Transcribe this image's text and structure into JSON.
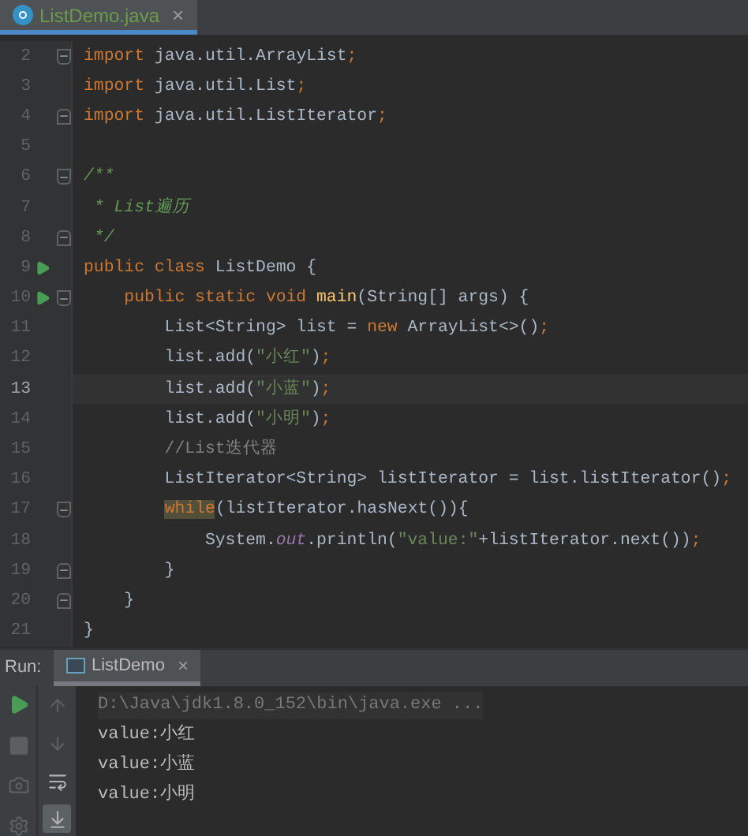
{
  "editor_tabs": [
    {
      "label": "ListDemo.java",
      "selected": true,
      "close": "×"
    }
  ],
  "code_lines": [
    {
      "number": "2",
      "fold_start": true,
      "fold_end": false,
      "run": false,
      "current": false,
      "tokens": [
        {
          "kind": "keyword",
          "text": "import "
        },
        {
          "kind": "plain",
          "text": "java.util.ArrayList"
        },
        {
          "kind": "keyword",
          "text": ";"
        }
      ]
    },
    {
      "number": "3",
      "fold_start": false,
      "fold_end": false,
      "run": false,
      "current": false,
      "tokens": [
        {
          "kind": "keyword",
          "text": "import "
        },
        {
          "kind": "plain",
          "text": "java.util.List"
        },
        {
          "kind": "keyword",
          "text": ";"
        }
      ]
    },
    {
      "number": "4",
      "fold_start": false,
      "fold_end": true,
      "run": false,
      "current": false,
      "tokens": [
        {
          "kind": "keyword",
          "text": "import "
        },
        {
          "kind": "plain",
          "text": "java.util.ListIterator"
        },
        {
          "kind": "keyword",
          "text": ";"
        }
      ]
    },
    {
      "number": "5",
      "fold_start": false,
      "fold_end": false,
      "run": false,
      "current": false
    },
    {
      "number": "6",
      "fold_start": true,
      "fold_end": false,
      "run": false,
      "current": false,
      "tokens": [
        {
          "kind": "doc",
          "text": "/**"
        }
      ]
    },
    {
      "number": "7",
      "fold_start": false,
      "fold_end": false,
      "run": false,
      "current": false,
      "tokens": [
        {
          "kind": "doc",
          "text": " * List遍历"
        }
      ]
    },
    {
      "number": "8",
      "fold_start": false,
      "fold_end": true,
      "run": false,
      "current": false,
      "tokens": [
        {
          "kind": "doc",
          "text": " */"
        }
      ]
    },
    {
      "number": "9",
      "fold_start": false,
      "fold_end": false,
      "run": true,
      "current": false,
      "tokens": [
        {
          "kind": "keyword",
          "text": "public class "
        },
        {
          "kind": "plain",
          "text": "ListDemo {"
        }
      ]
    },
    {
      "number": "10",
      "fold_start": true,
      "fold_end": false,
      "run": true,
      "current": false,
      "tokens": [
        {
          "kind": "keyword",
          "text": "    public static void "
        },
        {
          "kind": "method",
          "text": "main"
        },
        {
          "kind": "plain",
          "text": "(String[] args) {"
        }
      ]
    },
    {
      "number": "11",
      "fold_start": false,
      "fold_end": false,
      "run": false,
      "current": false,
      "tokens": [
        {
          "kind": "plain",
          "text": "        List<String> list = "
        },
        {
          "kind": "keyword",
          "text": "new "
        },
        {
          "kind": "plain",
          "text": "ArrayList<>()"
        },
        {
          "kind": "keyword",
          "text": ";"
        }
      ]
    },
    {
      "number": "12",
      "fold_start": false,
      "fold_end": false,
      "run": false,
      "current": false,
      "tokens": [
        {
          "kind": "plain",
          "text": "        list.add("
        },
        {
          "kind": "string",
          "text": "\"小红\""
        },
        {
          "kind": "plain",
          "text": ")"
        },
        {
          "kind": "keyword",
          "text": ";"
        }
      ]
    },
    {
      "number": "13",
      "fold_start": false,
      "fold_end": false,
      "run": false,
      "current": true,
      "tokens": [
        {
          "kind": "plain",
          "text": "        list.add("
        },
        {
          "kind": "string",
          "text": "\"小蓝\""
        },
        {
          "kind": "plain",
          "text": ")"
        },
        {
          "kind": "keyword",
          "text": ";"
        }
      ]
    },
    {
      "number": "14",
      "fold_start": false,
      "fold_end": false,
      "run": false,
      "current": false,
      "tokens": [
        {
          "kind": "plain",
          "text": "        list.add("
        },
        {
          "kind": "string",
          "text": "\"小明\""
        },
        {
          "kind": "plain",
          "text": ")"
        },
        {
          "kind": "keyword",
          "text": ";"
        }
      ]
    },
    {
      "number": "15",
      "fold_start": false,
      "fold_end": false,
      "run": false,
      "current": false,
      "tokens": [
        {
          "kind": "comment",
          "text": "        //List迭代器"
        }
      ]
    },
    {
      "number": "16",
      "fold_start": false,
      "fold_end": false,
      "run": false,
      "current": false,
      "tokens": [
        {
          "kind": "plain",
          "text": "        ListIterator<String> listIterator = list.listIterator()"
        },
        {
          "kind": "keyword",
          "text": ";"
        }
      ]
    },
    {
      "number": "17",
      "fold_start": true,
      "fold_end": false,
      "run": false,
      "current": false,
      "tokens": [
        {
          "kind": "highlight",
          "text": "while"
        },
        {
          "kind": "plain",
          "text": "(listIterator.hasNext()){"
        }
      ],
      "indent": true
    },
    {
      "number": "18",
      "fold_start": false,
      "fold_end": false,
      "run": false,
      "current": false,
      "tokens": [
        {
          "kind": "plain",
          "text": "            System."
        },
        {
          "kind": "field",
          "text": "out"
        },
        {
          "kind": "plain",
          "text": ".println("
        },
        {
          "kind": "string",
          "text": "\"value:\""
        },
        {
          "kind": "plain",
          "text": "+listIterator.next())"
        },
        {
          "kind": "keyword",
          "text": ";"
        }
      ]
    },
    {
      "number": "19",
      "fold_start": false,
      "fold_end": true,
      "run": false,
      "current": false,
      "tokens": [
        {
          "kind": "plain",
          "text": "        }"
        }
      ]
    },
    {
      "number": "20",
      "fold_start": false,
      "fold_end": true,
      "run": false,
      "current": false,
      "tokens": [
        {
          "kind": "plain",
          "text": "    }"
        }
      ]
    },
    {
      "number": "21",
      "fold_start": false,
      "fold_end": false,
      "run": false,
      "current": false,
      "tokens": [
        {
          "kind": "plain",
          "text": "}"
        }
      ]
    }
  ],
  "run_panel": {
    "label": "Run:",
    "tabs": [
      {
        "label": "ListDemo",
        "selected": true,
        "close": "×"
      }
    ],
    "tools_left": [
      {
        "kind": "run",
        "disabled": false
      },
      {
        "kind": "stop",
        "disabled": true
      },
      {
        "kind": "camera",
        "disabled": true
      },
      {
        "kind": "gear",
        "disabled": true
      }
    ],
    "tools_right": [
      {
        "kind": "up",
        "selected": false
      },
      {
        "kind": "down",
        "selected": false
      },
      {
        "kind": "wrap",
        "selected": false
      },
      {
        "kind": "scroll-end",
        "selected": true
      }
    ],
    "console": [
      {
        "kind": "command",
        "text": "D:\\Java\\jdk1.8.0_152\\bin\\java.exe ..."
      },
      {
        "kind": "output",
        "text": "value:小红"
      },
      {
        "kind": "output",
        "text": "value:小蓝"
      },
      {
        "kind": "output",
        "text": "value:小明"
      }
    ]
  }
}
